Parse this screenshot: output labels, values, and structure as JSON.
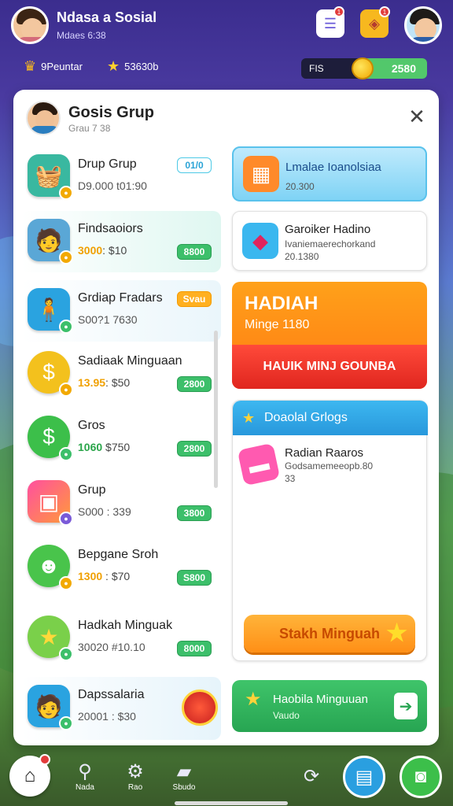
{
  "header": {
    "title": "Ndasa a Sosial",
    "subtitle": "Mdaes 6:38",
    "notif_count": "1",
    "gift_count": "1"
  },
  "stats": {
    "stat1": "9Peuntar",
    "stat2": "53630b",
    "coin_label": "FIS",
    "coin_value": "2580"
  },
  "panel": {
    "title": "Gosis Grup",
    "subtitle": "Grau 7 38"
  },
  "list": [
    {
      "title": "Drup Grup",
      "line": "D9.000 t01:90",
      "badge": "01/0",
      "icon": "basket-icon",
      "color": "#39b8a0"
    },
    {
      "title": "Findsaoiors",
      "highlight": "3000",
      "rest": ": $10",
      "badge": "8800",
      "icon": "avatar-icon",
      "color": "#5aa7d6"
    },
    {
      "title": "Grdiap Fradars",
      "line": "S00?1 7630",
      "badge": "Svau",
      "icon": "player-icon",
      "color": "#2aa3e0"
    },
    {
      "title": "Sadiaak Minguaan",
      "highlight": "13.95",
      "rest": ": $50",
      "badge": "2800",
      "icon": "dollar-coin-icon",
      "color": "#f3c11d"
    },
    {
      "title": "Gros",
      "highlight": "1060",
      "rest": " $750",
      "badge": "2800",
      "icon": "money-bag-icon",
      "color": "#3cbf4a"
    },
    {
      "title": "Grup",
      "line": "S000 : 339",
      "badge": "3800",
      "icon": "cube-icon",
      "color": "#ff7a3a"
    },
    {
      "title": "Bepgane Sroh",
      "highlight": "1300",
      "rest": " : $70",
      "badge": "S800",
      "icon": "frog-icon",
      "color": "#49c44b"
    },
    {
      "title": "Hadkah Minguak",
      "line": "30020 #10.10",
      "badge": "8000",
      "icon": "star-coin-icon",
      "color": "#7ad04a"
    }
  ],
  "list_bottom": {
    "title": "Dapssalaria",
    "line": "20001 : $30",
    "icon": "hero-icon"
  },
  "cards": {
    "c1_title": "Lmalae Ioanolsiaa",
    "c1_sub": "20.300",
    "c2_title": "Garoiker Hadino",
    "c2_sub": "Ivaniemaerechorkand",
    "c2_sub2": "20.1380",
    "hadiah_title": "HADIAH",
    "hadiah_sub": "Minge 1180",
    "hadiah_button": "HAUIK MINJ GOUNBA",
    "tab_label": "Doaolal Grlogs",
    "reward_title": "Radian Raaros",
    "reward_sub": "Godsamemeeopb.80",
    "reward_sub2": "33",
    "claim_button": "Stakh Minguah",
    "bottom_title": "Haobila Minguuan",
    "bottom_sub": "Vaudo"
  },
  "nav": {
    "n1": "Nada",
    "n2": "Rao",
    "n3": "Sbudo"
  }
}
